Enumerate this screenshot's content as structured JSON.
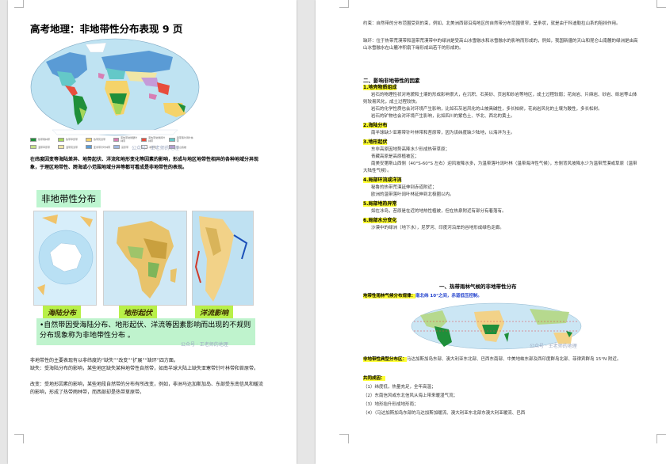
{
  "left": {
    "title": "高考地理：非地带性分布表现 9 页",
    "legend": [
      {
        "label": "热带雨林带",
        "color": "#1f8f3a"
      },
      {
        "label": "热带草原带",
        "color": "#a6d65a"
      },
      {
        "label": "热带荒漠带",
        "color": "#f5d36a"
      },
      {
        "label": "亚热带常绿硬叶林带",
        "color": "#d77fb4"
      },
      {
        "label": "亚热带常绿阔叶林带",
        "color": "#e84d3c"
      },
      {
        "label": "温带落叶阔叶林带",
        "color": "#64c8c8"
      },
      {
        "label": "温带草原带",
        "color": "#c6e08a"
      },
      {
        "label": "温带荒漠带",
        "color": "#f0e6a6"
      },
      {
        "label": "亚寒带针叶林带",
        "color": "#5a9bd5"
      },
      {
        "label": "苔原带",
        "color": "#a0b8e0"
      },
      {
        "label": "冰原带",
        "color": "#ffffff"
      },
      {
        "label": "高山植被",
        "color": "#c59bd9"
      }
    ],
    "map_watermark": "公众号 · 王老师的地理",
    "intro_text": "在纬度因变等海陆差异、地势起伏、洋流和地形变化等因素的影响，形成与地区地带性相异的各种地域分异现象，于理区地带性、跨海或小范围地域分异等都可看成是非地带性的表现。",
    "section_heading": "非地带性分布",
    "panels": [
      {
        "label": "海陆分布"
      },
      {
        "label": "地形起伏"
      },
      {
        "label": "洋流影响"
      }
    ],
    "summary": "•自然带因受海陆分布、地形起伏、洋流等因素影响而出现的不规则分布现象称为非地带性分布 。",
    "summary_watermark": "公众号 · 王老师的地理",
    "bottom_lines": [
      "非地带性的主要表现有以非纬度的“缺失”“改变”“扩展”“缺环”四方面。",
      "缺失：受海陆分布的影响，某些地区缺失某种地带性自然带，如南半球大陆上缺失亚寒带针叶林带和苔原带。",
      "改变：受地形因素的影响，某些地段自然带的分布有所改变，例如，非洲马达加斯加岛、东部受东南信风和暖流的影响，形成了热带雨林带，而西部却是热带草原带。"
    ]
  },
  "right": {
    "top_paras": [
      "约束：自然带的分布范围受到的束，例如，北美洲西部沿海地区的自然带分布范围很窄，呈条状，就是由于科迪勒拉山系的阻挡作用。",
      "缺环：位于热带荒漠带和温带荒漠带中的绿洲是受高山冰雪融水和冰雪融水的影响而形成的，例如，我国新疆的天山和昆仑山南麓的绿洲是由高山冰雪融水在山麓冲积扇下缘形成出若干的形成的。"
    ],
    "section2_title": "二、影响非地带性的因素",
    "factors": [
      {
        "title": "1.地壳物质组成",
        "lines": [
          "岩石的物理性状对地貌和土壤的形成影响很大，在沉积、石英砂、页岩和砂岩等地区，成土过程较弱；花岗岩、片麻岩、砂岩、砾岩等山体则较易风化，成土过程较快。",
          "岩石的化学性质也会对环境产生影响，比如石灰岩风化的山坡具碱性，多长柏树，花岗岩风化的土壤为酸性，多长松树。",
          "岩石的矿物也会对环境产生影响，比如四川的紫色土、华北、西北的黄土。"
        ]
      },
      {
        "title": "2.海陆分布",
        "lines": [
          "南半球缺少亚寒带针叶林带和苔原带，因为该纬度缺少陆地，以海洋为主。"
        ]
      },
      {
        "title": "3.地形起伏",
        "lines": [
          "东非高原因地势高降水少形成热带草原；",
          "青藏高原是高原植被区；",
          "南美安第斯山西侧（40°S-60°S 左右）迎风坡降水多，为温带落叶阔叶林（温带海洋性气候），东侧背风坡降水少为温带荒漠或草原（温带大陆性气候）。"
        ]
      },
      {
        "title": "4.局部环流或洋流",
        "lines": [
          "秘鲁的热带荒漠延伸到赤道附近；",
          "欧洲的温带落叶阔叶林延伸到北极圈以内。"
        ]
      },
      {
        "title": "5.局部地热异常",
        "lines": [
          "如在冰岛，苔原是在近的地热性植被，但在热泉附近有部分有着落有。"
        ]
      },
      {
        "title": "6.局部水分变化",
        "lines": [
          "沙漠中的绿洲（地下水），尼罗河、印度河沿岸的谷地形成绿色走廊。"
        ]
      }
    ],
    "section3_title": "一、热带雨林气候的非地带性分布",
    "distribution_label": "地带性雨林气候分布规律：",
    "distribution_text": "南北纬 10°之间，赤道低压控制。",
    "map_watermark": "公众号 · 王老师的地理",
    "nonzonal_label": "非地带性典型分布区：",
    "nonzonal_text": "马达加斯加岛东部、澳大利亚东北部、巴西东南部、中美地峡东部及西印度群岛北部、菲律宾群岛 15°N 附近。",
    "cause_label": "共同成因：",
    "causes": [
      "（1）纬度低，热量充足，全年高温；",
      "（2）东南信风或东北信风从海上带来暖湿气流；",
      "（3）地形抬升形成地形雨；",
      "（4）（马达加斯加岛东部的马达加斯加暖流、澳大利亚东北部东澳大利亚暖流、巴西"
    ]
  }
}
